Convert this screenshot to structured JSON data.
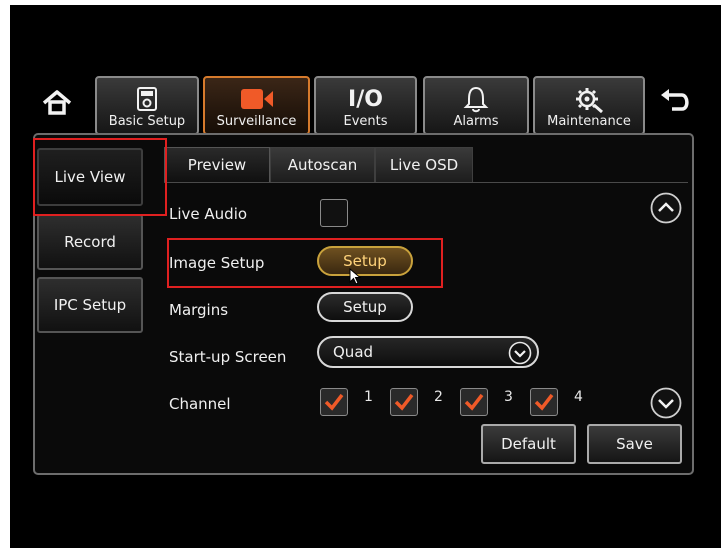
{
  "nav": {
    "tabs": [
      {
        "label": "Basic Setup",
        "icon": "settings-page-icon"
      },
      {
        "label": "Surveillance",
        "icon": "camera-icon"
      },
      {
        "label": "Events",
        "icon_text": "I/O"
      },
      {
        "label": "Alarms",
        "icon": "bell-icon"
      },
      {
        "label": "Maintenance",
        "icon": "gear-wrench-icon"
      }
    ],
    "active_tab": "Surveillance"
  },
  "sidebar": {
    "items": [
      {
        "label": "Live View"
      },
      {
        "label": "Record"
      },
      {
        "label": "IPC Setup"
      }
    ],
    "active": "Live View"
  },
  "subtabs": {
    "items": [
      {
        "label": "Preview"
      },
      {
        "label": "Autoscan"
      },
      {
        "label": "Live OSD"
      }
    ],
    "active": "Preview"
  },
  "form": {
    "live_audio": {
      "label": "Live Audio",
      "checked": false
    },
    "image_setup": {
      "label": "Image Setup",
      "button": "Setup"
    },
    "margins": {
      "label": "Margins",
      "button": "Setup"
    },
    "startup_screen": {
      "label": "Start-up Screen",
      "value": "Quad"
    },
    "channel": {
      "label": "Channel",
      "items": [
        {
          "num": "1",
          "checked": true
        },
        {
          "num": "2",
          "checked": true
        },
        {
          "num": "3",
          "checked": true
        },
        {
          "num": "4",
          "checked": true
        }
      ]
    }
  },
  "actions": {
    "default_label": "Default",
    "save_label": "Save"
  },
  "colors": {
    "accent": "#d67a2c",
    "check": "#f05a28",
    "highlight": "#e02020",
    "selected_button": "#c9a23c"
  }
}
